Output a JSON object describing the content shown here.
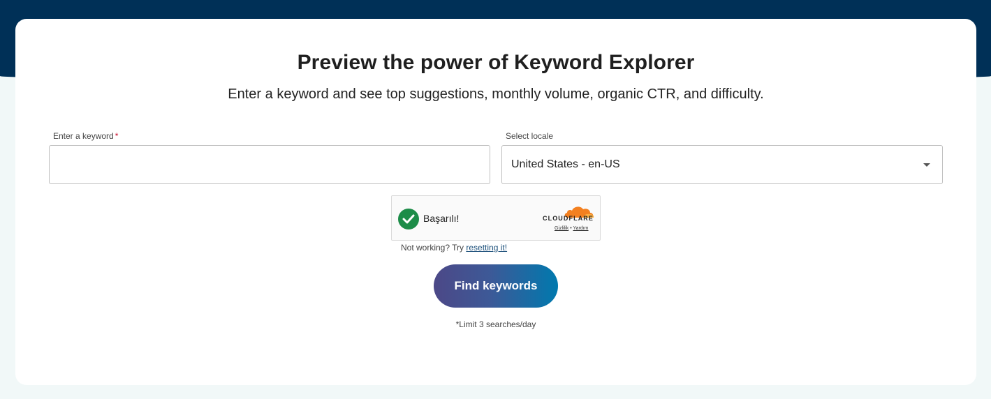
{
  "header": {
    "title": "Preview the power of Keyword Explorer",
    "subtitle": "Enter a keyword and see top suggestions, monthly volume, organic CTR, and difficulty."
  },
  "form": {
    "keyword_label": "Enter a keyword",
    "required_mark": "*",
    "keyword_value": "",
    "locale_label": "Select locale",
    "locale_value": "United States - en-US"
  },
  "captcha": {
    "status": "Başarılı!",
    "provider": "CLOUDFLARE",
    "privacy_link": "Gizlilik",
    "separator": "•",
    "help_link": "Yardım",
    "success_color": "#1c8c48",
    "brand_color": "#f38020"
  },
  "reset": {
    "prefix": "Not working? Try",
    "link": "resetting it!"
  },
  "submit": {
    "label": "Find keywords"
  },
  "limit_note": "*Limit 3 searches/day",
  "colors": {
    "top_band": "#003057",
    "background": "#f1f8f8",
    "button_start": "#4c4887",
    "button_end": "#0079ae"
  }
}
